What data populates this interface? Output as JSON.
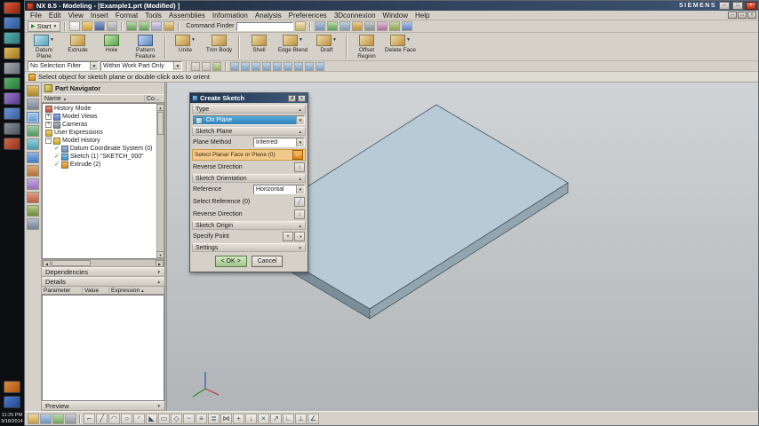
{
  "glyphs": {
    "down": "▼",
    "up": "▲",
    "left": "◀",
    "right": "▶",
    "plus": "+",
    "minus": "−",
    "check": "✓",
    "close": "×",
    "minimize": "─",
    "maximize": "□",
    "play": "▶",
    "reverse": "↕",
    "plane": "▱",
    "slash": "╱",
    "dot": "∙",
    "reset": "↺"
  },
  "taskbar": {
    "time": "11:25 PM",
    "date": "9/18/2014"
  },
  "window": {
    "title": "NX 8.5 - Modeling - [Example1.prt (Modified) ]",
    "brand": "SIEMENS"
  },
  "menu": {
    "items": [
      "File",
      "Edit",
      "View",
      "Insert",
      "Format",
      "Tools",
      "Assemblies",
      "Information",
      "Analysis",
      "Preferences",
      "3Dconnexion",
      "Window",
      "Help"
    ]
  },
  "toolbar_standard": {
    "start_label": "Start",
    "command_finder_label": "Command Finder",
    "left_icons": [
      "new",
      "open",
      "save",
      "print",
      "undo",
      "redo",
      "copy",
      "paste"
    ],
    "right_icons": [
      "find",
      "window",
      "refresh-display",
      "fit-view",
      "orient-view",
      "render-style",
      "show-and-hide",
      "move-object",
      "help"
    ]
  },
  "toolbar_features": {
    "buttons": [
      {
        "label": "Datum Plane"
      },
      {
        "label": "Extrude"
      },
      {
        "label": "Hole"
      },
      {
        "label": "Pattern Feature"
      },
      {
        "label": "Unite"
      },
      {
        "label": "Trim Body"
      },
      {
        "label": "Shell"
      },
      {
        "label": "Edge Blend"
      },
      {
        "label": "Draft"
      },
      {
        "label": "Offset Region"
      },
      {
        "label": "Delete Face"
      }
    ]
  },
  "selection_bar": {
    "filter": "No Selection Filter",
    "scope": "Within Work Part Only",
    "icons": [
      "select-all",
      "deselect-all",
      "highlight",
      "snap-point",
      "end-point",
      "mid-point",
      "control-point",
      "intersection-point",
      "arc-center",
      "quadrant-point",
      "existing-point",
      "point-on-curve"
    ]
  },
  "prompt": {
    "text": "Select object for sketch plane or double-click axis to orient"
  },
  "resource_bar": {
    "icons": [
      "assembly-navigator",
      "constraint-navigator",
      "part-navigator",
      "reuse-library",
      "hd3d-tools",
      "web-browser",
      "history",
      "process-studio",
      "manufacturing-wizards",
      "roles",
      "system-scenes"
    ]
  },
  "part_navigator": {
    "header": "Part Navigator",
    "name_column": "Name",
    "comment_column": "Co...",
    "tree": [
      {
        "label": "History Mode"
      },
      {
        "label": "Model Views"
      },
      {
        "label": "Cameras"
      },
      {
        "label": "User Expressions"
      },
      {
        "label": "Model History"
      },
      {
        "label": "Datum Coordinate System (0)"
      },
      {
        "label": "Sketch (1) \"SKETCH_000\""
      },
      {
        "label": "Extrude (2)"
      }
    ],
    "dependencies_header": "Dependencies",
    "details_header": "Details",
    "details_columns": {
      "parameter": "Parameter",
      "value": "Value",
      "expression": "Expression"
    },
    "preview_header": "Preview"
  },
  "dialog": {
    "title": "Create Sketch",
    "type_header": "Type",
    "type_value": "On Plane",
    "plane_header": "Sketch Plane",
    "plane_method_label": "Plane Method",
    "plane_method_value": "Inferred",
    "select_planar_label": "Select Planar Face or Plane (0)",
    "reverse_direction_label": "Reverse Direction",
    "orientation_header": "Sketch Orientation",
    "reference_label": "Reference",
    "reference_value": "Horizontal",
    "select_reference_label": "Select Reference (0)",
    "reverse_direction2_label": "Reverse Direction",
    "origin_header": "Sketch Origin",
    "specify_point_label": "Specify Point",
    "settings_header": "Settings",
    "ok_label": "< OK >",
    "cancel_label": "Cancel"
  },
  "sketch_toolbar": {
    "left_icons": [
      "bottom-icon-1",
      "bottom-icon-2",
      "bottom-icon-3",
      "bottom-icon-4"
    ],
    "icons": [
      {
        "name": "profile",
        "glyph": "⌐"
      },
      {
        "name": "line",
        "glyph": "╱"
      },
      {
        "name": "arc",
        "glyph": "◠"
      },
      {
        "name": "circle",
        "glyph": "○"
      },
      {
        "name": "fillet",
        "glyph": "◜"
      },
      {
        "name": "chamfer",
        "glyph": "◣"
      },
      {
        "name": "rectangle",
        "glyph": "▭"
      },
      {
        "name": "polygon",
        "glyph": "◇"
      },
      {
        "name": "studio-spline",
        "glyph": "~"
      },
      {
        "name": "offset-curve",
        "glyph": "≡"
      },
      {
        "name": "pattern-curve",
        "glyph": "≣"
      },
      {
        "name": "mirror-curve",
        "glyph": "⋈"
      },
      {
        "name": "intersection-point",
        "glyph": "+"
      },
      {
        "name": "project-curve",
        "glyph": "↓"
      },
      {
        "name": "quick-trim",
        "glyph": "×"
      },
      {
        "name": "quick-extend",
        "glyph": "↗"
      },
      {
        "name": "make-corner",
        "glyph": "∟"
      },
      {
        "name": "geometric-constraints",
        "glyph": "⊥"
      },
      {
        "name": "inferred-dimensions",
        "glyph": "∠"
      }
    ]
  },
  "colors": {
    "accent_blue": "#3f97d4",
    "selection_orange": "#f2c98c",
    "ok_green": "#b9d4a8",
    "slab_top": "#b7cad5",
    "titlebar": "#2c3e58"
  }
}
